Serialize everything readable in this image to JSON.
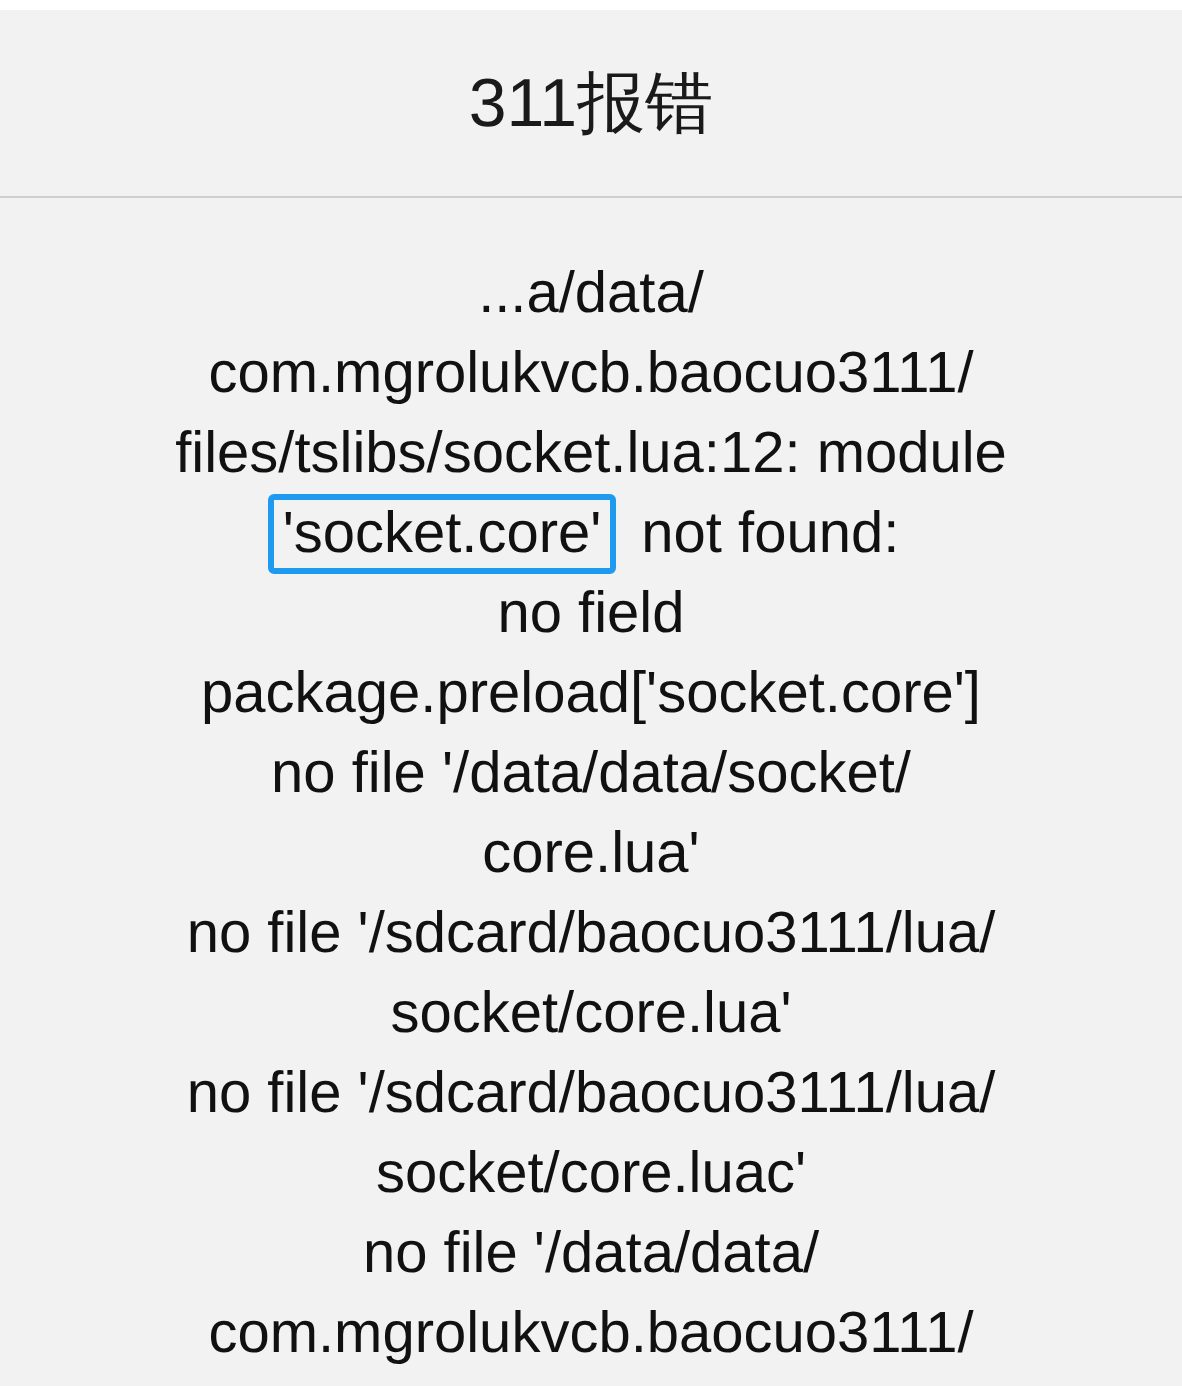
{
  "dialog": {
    "title": "311报错",
    "lines": [
      [
        {
          "text": "...a/data/",
          "highlighted": false
        }
      ],
      [
        {
          "text": "com.mgrolukvcb.baocuo3111/",
          "highlighted": false
        }
      ],
      [
        {
          "text": "files/tslibs/socket.lua:12: module",
          "highlighted": false
        }
      ],
      [
        {
          "text": "'socket.core'",
          "highlighted": true
        },
        {
          "text": "not found:",
          "highlighted": false
        }
      ],
      [
        {
          "text": "no field",
          "highlighted": false
        }
      ],
      [
        {
          "text": "package.preload['socket.core']",
          "highlighted": false
        }
      ],
      [
        {
          "text": "no file '/data/data/socket/",
          "highlighted": false
        }
      ],
      [
        {
          "text": "core.lua'",
          "highlighted": false
        }
      ],
      [
        {
          "text": "no file '/sdcard/baocuo3111/lua/",
          "highlighted": false
        }
      ],
      [
        {
          "text": "socket/core.lua'",
          "highlighted": false
        }
      ],
      [
        {
          "text": "no file '/sdcard/baocuo3111/lua/",
          "highlighted": false
        }
      ],
      [
        {
          "text": "socket/core.luac'",
          "highlighted": false
        }
      ],
      [
        {
          "text": "no file '/data/data/",
          "highlighted": false
        }
      ],
      [
        {
          "text": "com.mgrolukvcb.baocuo3111/",
          "highlighted": false
        }
      ]
    ]
  }
}
